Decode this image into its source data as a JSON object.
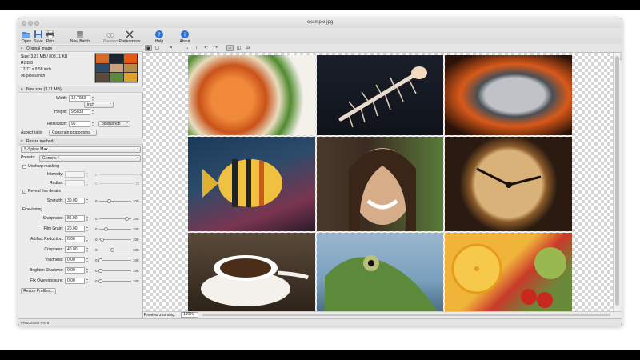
{
  "window": {
    "title": "example.jpg"
  },
  "toolbar": {
    "open": "Open",
    "save": "Save",
    "print": "Print",
    "new_batch": "New Batch",
    "preview": "Preview",
    "preferences": "Preferences",
    "help": "Help",
    "about": "About"
  },
  "original": {
    "header": "Original image",
    "size": "Size: 3.21 MB / 803.11 KB",
    "mode": "RGB/8",
    "dimensions": "12.71 x 9.58 inch",
    "resolution": "96 pixels/inch"
  },
  "new_size": {
    "header": "New size (3.21 MB)",
    "width_label": "Width:",
    "width_value": "12.7083",
    "height_label": "Height:",
    "height_value": "9.5833",
    "unit": "inch",
    "resolution_label": "Resolution:",
    "resolution_value": "96",
    "resolution_unit": "pixels/inch",
    "aspect_label": "Aspect ratio:",
    "aspect_value": "Constrain proportions"
  },
  "resize": {
    "header": "Resize method",
    "method": "S-Spline Max",
    "presets_label": "Presets:",
    "presets_value": "Generic *",
    "unsharp_label": "Unsharp masking",
    "intensity_label": "Intensity:",
    "intensity_min": "0",
    "intensity_max": "5",
    "radius_label": "Radius:",
    "radius_min": "0",
    "radius_max": "10",
    "reveal_label": "Reveal fine details",
    "strength_label": "Strength:",
    "strength_value": "30.00",
    "strength_min": "0",
    "strength_max": "100",
    "finetune_label": "Fine-tuning",
    "sharpness_label": "Sharpness:",
    "sharpness_value": "86.00",
    "sharpness_min": "0",
    "sharpness_max": "100",
    "filmgrain_label": "Film Grain:",
    "filmgrain_value": "20.00",
    "filmgrain_min": "0",
    "filmgrain_max": "100",
    "artifact_label": "Artifact Reduction:",
    "artifact_value": "6.00",
    "artifact_min": "0",
    "artifact_max": "100",
    "crispness_label": "Crispness:",
    "crispness_value": "40.00",
    "crispness_min": "0",
    "crispness_max": "100",
    "vividness_label": "Vividness:",
    "vividness_value": "0.00",
    "vividness_min": "0",
    "vividness_max": "100",
    "brighten_label": "Brighten Shadows:",
    "brighten_value": "0.00",
    "brighten_min": "0",
    "brighten_max": "100",
    "fixover_label": "Fix Overexposure:",
    "fixover_value": "0.00",
    "fixover_min": "0",
    "fixover_max": "100",
    "profiles_button": "Resize Profiles..."
  },
  "status": {
    "app": "PhotoZoom Pro 8"
  },
  "zoom": {
    "label": "Preview zooming:",
    "value": "100%"
  },
  "photos": [
    {
      "name": "roasted-vegetables",
      "color": "#d86a25"
    },
    {
      "name": "seashell",
      "color": "#1d2430"
    },
    {
      "name": "grill-pan",
      "color": "#e25a14"
    },
    {
      "name": "tropical-fish",
      "color": "#2c4b6a"
    },
    {
      "name": "smiling-woman",
      "color": "#caa07e"
    },
    {
      "name": "clock",
      "color": "#b98a4c"
    },
    {
      "name": "coffee-cup",
      "color": "#5a4a3a"
    },
    {
      "name": "frog",
      "color": "#5c8a3a"
    },
    {
      "name": "fruit",
      "color": "#e1a02a"
    }
  ]
}
